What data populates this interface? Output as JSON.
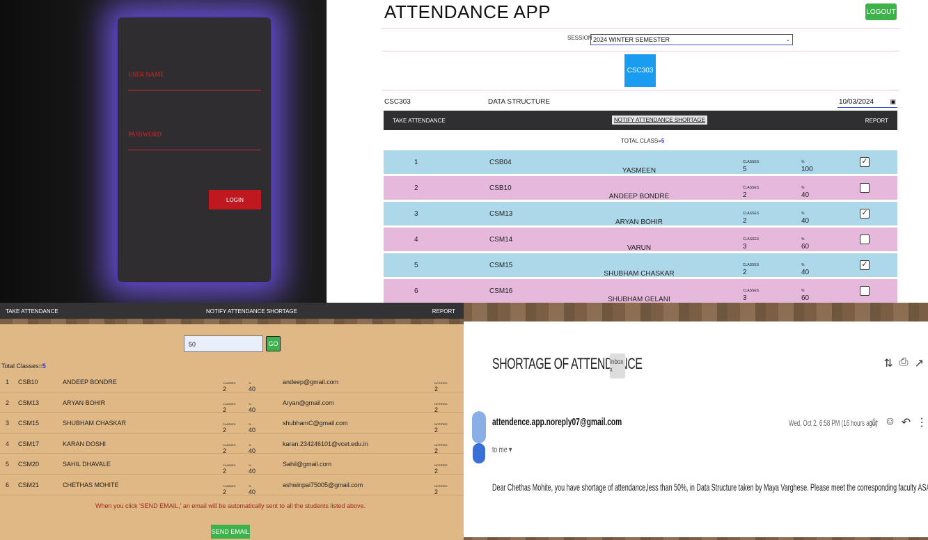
{
  "login": {
    "username_label": "USER NAME",
    "password_label": "PASSWORD",
    "login_button": "LOGIN"
  },
  "app": {
    "title": "ATTENDANCE APP",
    "logout_label": "LOGOUT",
    "session_label": "SESSION",
    "session_value": "2024 WINTER SEMESTER",
    "course_button": "CSC303",
    "course_code": "CSC303",
    "course_name": "DATA STRUCTURE",
    "date_value": "10/03/2024",
    "toolbar": {
      "take_attendance": "TAKE ATTENDANCE",
      "notify": "NOTIFY ATTENDANCE SHORTAGE",
      "report": "REPORT"
    },
    "total_class_label": "TOTAL CLASS=",
    "total_class_value": "5",
    "classes_unit": "CLASSES",
    "percent_unit": "%",
    "rows": [
      {
        "num": "1",
        "roll": "CSB04",
        "name": "YASMEEN",
        "classes": "5",
        "pct": "100",
        "checked": true,
        "color": "blue"
      },
      {
        "num": "2",
        "roll": "CSB10",
        "name": "ANDEEP BONDRE",
        "classes": "2",
        "pct": "40",
        "checked": false,
        "color": "pink"
      },
      {
        "num": "3",
        "roll": "CSM13",
        "name": "ARYAN BOHIR",
        "classes": "2",
        "pct": "40",
        "checked": true,
        "color": "blue"
      },
      {
        "num": "4",
        "roll": "CSM14",
        "name": "VARUN",
        "classes": "3",
        "pct": "60",
        "checked": false,
        "color": "pink"
      },
      {
        "num": "5",
        "roll": "CSM15",
        "name": "SHUBHAM CHASKAR",
        "classes": "2",
        "pct": "40",
        "checked": true,
        "color": "blue"
      },
      {
        "num": "6",
        "roll": "CSM16",
        "name": "SHUBHAM GELANI",
        "classes": "3",
        "pct": "60",
        "checked": false,
        "color": "pink"
      }
    ]
  },
  "shortage": {
    "toolbar": {
      "take_attendance": "TAKE ATTENDANCE",
      "notify": "NOTIFY ATTENDANCE SHORTAGE",
      "report": "REPORT"
    },
    "threshold_value": "50",
    "go_label": "GO",
    "total_classes_label": "Total Classes=",
    "total_classes_value": "5",
    "classes_unit": "CLASSES",
    "percent_unit": "%",
    "notified_unit": "NOTIFIED",
    "rows": [
      {
        "num": "1",
        "roll": "CSB10",
        "name": "ANDEEP BONDRE",
        "classes": "2",
        "pct": "40",
        "email": "andeep@gmail.com",
        "notified": "2"
      },
      {
        "num": "2",
        "roll": "CSM13",
        "name": "ARYAN BOHIR",
        "classes": "2",
        "pct": "40",
        "email": "Aryan@gmail.com",
        "notified": "2"
      },
      {
        "num": "3",
        "roll": "CSM15",
        "name": "SHUBHAM CHASKAR",
        "classes": "2",
        "pct": "40",
        "email": "shubhamC@gmail.com",
        "notified": "2"
      },
      {
        "num": "4",
        "roll": "CSM17",
        "name": "KARAN DOSHI",
        "classes": "2",
        "pct": "40",
        "email": "karan.234246101@vcet.edu.in",
        "notified": "2"
      },
      {
        "num": "5",
        "roll": "CSM20",
        "name": "SAHIL DHAVALE",
        "classes": "2",
        "pct": "40",
        "email": "Sahil@gmail.com",
        "notified": "2"
      },
      {
        "num": "6",
        "roll": "CSM21",
        "name": "CHETHAS MOHITE",
        "classes": "2",
        "pct": "40",
        "email": "ashwinpai75005@gmail.com",
        "notified": "2"
      }
    ],
    "email_note": "When you click 'SEND EMAIL,' an email will be automatically sent to all the students listed above.",
    "send_label": "SEND EMAIL"
  },
  "email": {
    "subject": "SHORTAGE OF ATTENDANCE",
    "inbox_chip": "Inbox x",
    "sender": "attendence.app.noreply07@gmail.com",
    "to_me": "to me ▾",
    "date": "Wed, Oct 2, 6:58 PM (16 hours ago)",
    "body": "Dear Chethas Mohite, you have shortage of attendance,less than 50%, in Data Structure  taken by Maya Varghese. Please meet the corresponding faculty ASAP."
  },
  "colors": {
    "accent_green": "#3db24a",
    "login_red": "#c0181f",
    "glow_purple": "#6a4fd8",
    "row_blue": "#acd8ea",
    "row_pink": "#e6b8dc",
    "course_blue": "#1a9cf0",
    "shortage_bg": "#dfb885"
  }
}
